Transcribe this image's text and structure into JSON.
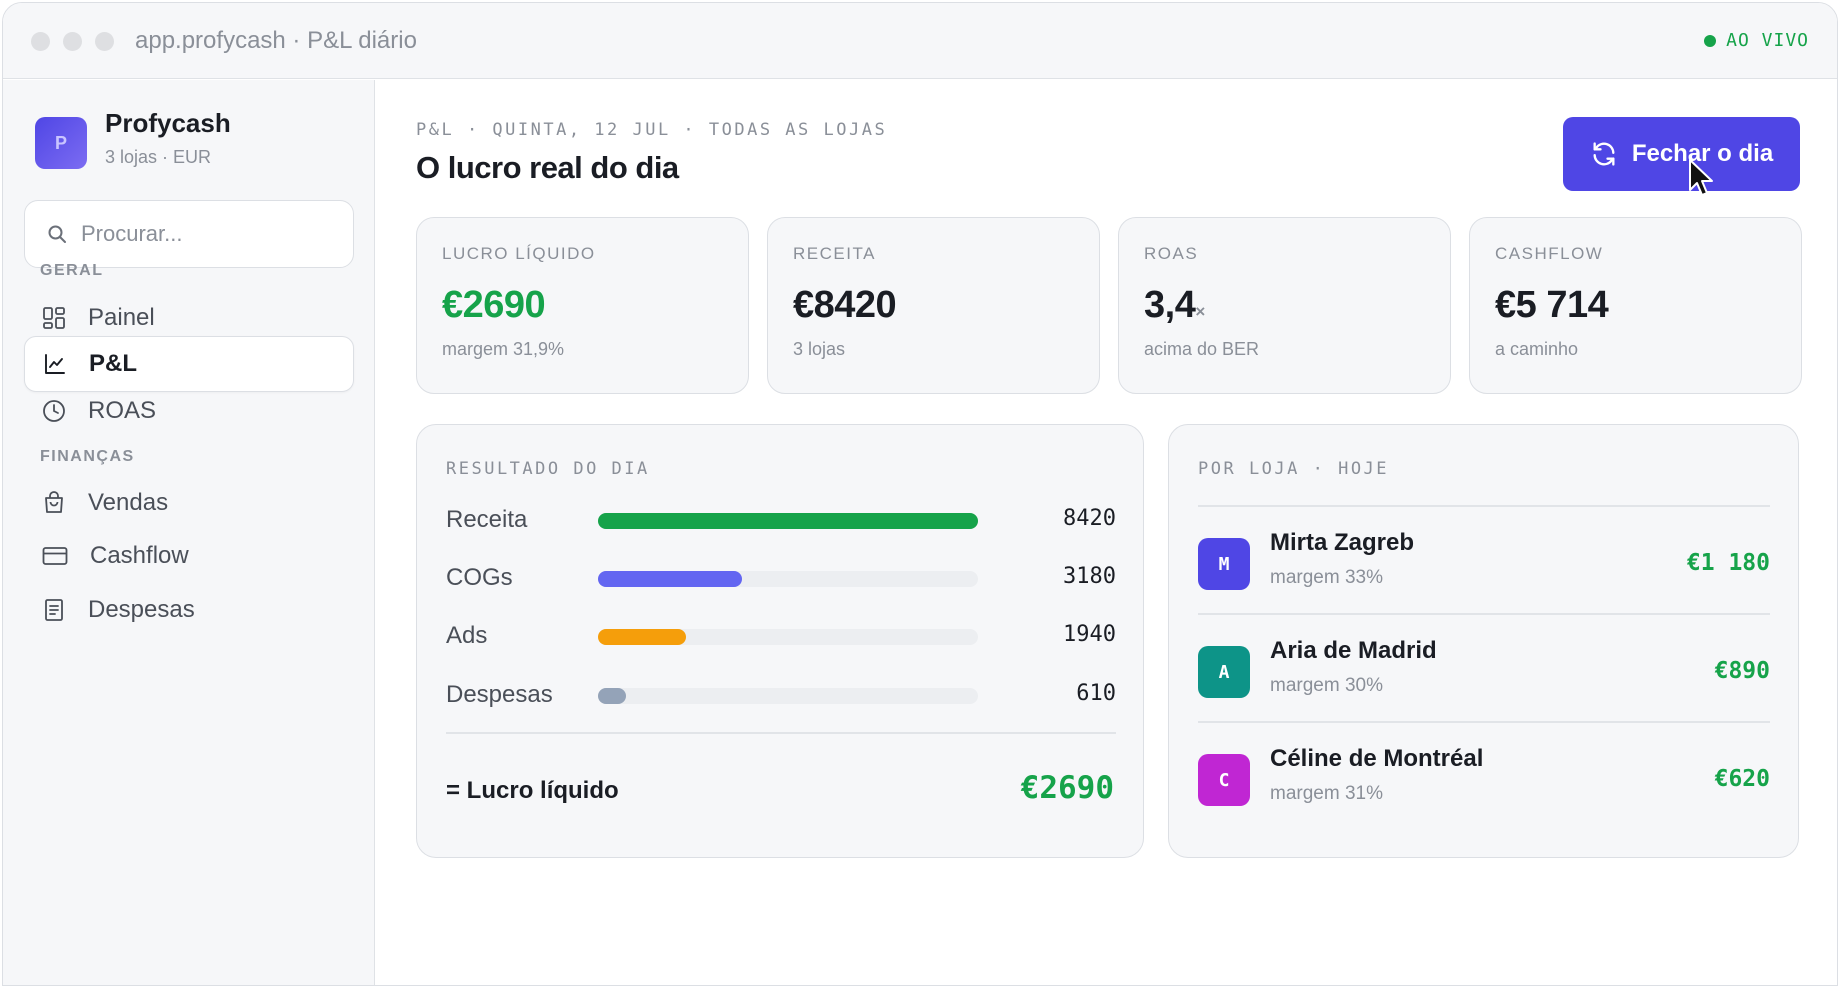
{
  "window": {
    "title": "app.profycash · P&L diário",
    "live_label": "AO VIVO"
  },
  "sidebar": {
    "brand": {
      "initial": "P",
      "name": "Profycash",
      "subtitle": "3 lojas · EUR"
    },
    "search": {
      "placeholder": "Procurar...",
      "value": ""
    },
    "sections": [
      {
        "label": "GERAL",
        "items": [
          {
            "label": "Painel",
            "icon": "dashboard-grid-icon",
            "active": false
          },
          {
            "label": "P&L",
            "icon": "line-chart-icon",
            "active": true
          },
          {
            "label": "ROAS",
            "icon": "clock-icon",
            "active": false
          }
        ]
      },
      {
        "label": "FINANÇAS",
        "items": [
          {
            "label": "Vendas",
            "icon": "shopping-bag-icon",
            "active": false
          },
          {
            "label": "Cashflow",
            "icon": "credit-card-icon",
            "active": false
          },
          {
            "label": "Despesas",
            "icon": "receipt-icon",
            "active": false
          }
        ]
      }
    ]
  },
  "header": {
    "kicker": "P&L · QUINTA, 12 JUL · TODAS AS LOJAS",
    "title": "O lucro real do dia",
    "close_button": {
      "label": "Fechar o dia",
      "icon": "refresh-icon"
    }
  },
  "kpis": [
    {
      "label": "LUCRO LÍQUIDO",
      "value": "€2690",
      "unit": "",
      "sub": "margem 31,9%",
      "highlight": "#16a34a"
    },
    {
      "label": "RECEITA",
      "value": "€8420",
      "unit": "",
      "sub": "3 lojas",
      "highlight": ""
    },
    {
      "label": "ROAS",
      "value": "3,4",
      "unit": "×",
      "sub": "acima do BER",
      "highlight": ""
    },
    {
      "label": "CASHFLOW",
      "value": "€5 714",
      "unit": "",
      "sub": "a caminho",
      "highlight": ""
    }
  ],
  "result": {
    "title": "RESULTADO DO DIA",
    "max_value": 8420,
    "rows": [
      {
        "label": "Receita",
        "value": 8420,
        "color": "#16a34a"
      },
      {
        "label": "COGs",
        "value": 3180,
        "color": "#6366f1"
      },
      {
        "label": "Ads",
        "value": 1940,
        "color": "#f59e0b"
      },
      {
        "label": "Despesas",
        "value": 610,
        "color": "#94a3b8"
      }
    ],
    "total_label": "= Lucro líquido",
    "total_value": "€2690"
  },
  "stores": {
    "title": "POR LOJA · HOJE",
    "items": [
      {
        "initial": "M",
        "name": "Mirta Zagreb",
        "margin": "margem 33%",
        "amount": "€1 180",
        "color": "#4f46e5"
      },
      {
        "initial": "A",
        "name": "Aria de Madrid",
        "margin": "margem 30%",
        "amount": "€890",
        "color": "#0d9488"
      },
      {
        "initial": "C",
        "name": "Céline de Montréal",
        "margin": "margem 31%",
        "amount": "€620",
        "color": "#c026d3"
      }
    ]
  },
  "colors": {
    "accent": "#4f46e5",
    "positive": "#16a34a"
  }
}
